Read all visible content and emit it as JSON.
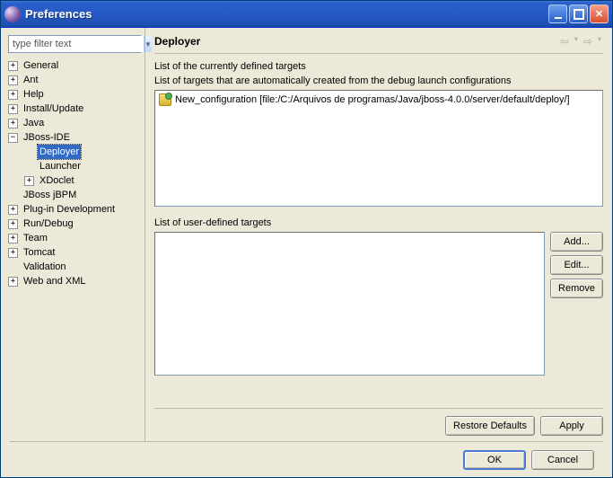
{
  "window": {
    "title": "Preferences"
  },
  "sidebar": {
    "filter_placeholder": "type filter text",
    "items": [
      {
        "expand": "+",
        "label": "General",
        "depth": 0
      },
      {
        "expand": "+",
        "label": "Ant",
        "depth": 0
      },
      {
        "expand": "+",
        "label": "Help",
        "depth": 0
      },
      {
        "expand": "+",
        "label": "Install/Update",
        "depth": 0
      },
      {
        "expand": "+",
        "label": "Java",
        "depth": 0
      },
      {
        "expand": "−",
        "label": "JBoss-IDE",
        "depth": 0
      },
      {
        "expand": "",
        "label": "Deployer",
        "depth": 1,
        "selected": true
      },
      {
        "expand": "",
        "label": "Launcher",
        "depth": 1
      },
      {
        "expand": "+",
        "label": "XDoclet",
        "depth": 1
      },
      {
        "expand": "",
        "label": "JBoss jBPM",
        "depth": 0
      },
      {
        "expand": "+",
        "label": "Plug-in Development",
        "depth": 0
      },
      {
        "expand": "+",
        "label": "Run/Debug",
        "depth": 0
      },
      {
        "expand": "+",
        "label": "Team",
        "depth": 0
      },
      {
        "expand": "+",
        "label": "Tomcat",
        "depth": 0
      },
      {
        "expand": "",
        "label": "Validation",
        "depth": 0
      },
      {
        "expand": "+",
        "label": "Web and XML",
        "depth": 0
      }
    ]
  },
  "panel": {
    "title": "Deployer",
    "list_heading": "List of the currently defined targets",
    "auto_list_label": "List of targets that are automatically created from the debug launch configurations",
    "auto_targets": [
      "New_configuration [file:/C:/Arquivos de programas/Java/jboss-4.0.0/server/default/deploy/]"
    ],
    "user_list_label": "List of user-defined targets",
    "buttons": {
      "add": "Add...",
      "edit": "Edit...",
      "remove": "Remove",
      "restore": "Restore Defaults",
      "apply": "Apply"
    }
  },
  "footer": {
    "ok": "OK",
    "cancel": "Cancel"
  }
}
